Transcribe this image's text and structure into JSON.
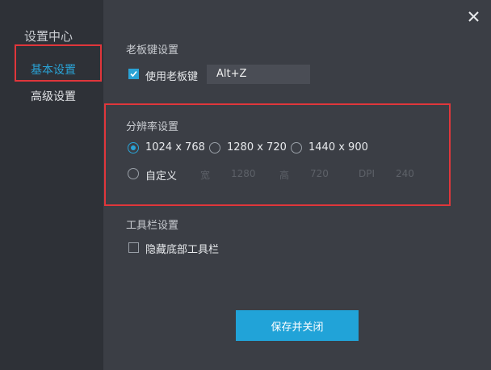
{
  "sidebar": {
    "title": "设置中心",
    "items": [
      {
        "label": "基本设置",
        "active": true
      },
      {
        "label": "高级设置",
        "active": false
      }
    ]
  },
  "close_icon": "close-icon",
  "boss_key": {
    "section_title": "老板键设置",
    "checkbox_label": "使用老板键",
    "checked": true,
    "hotkey_value": "Alt+Z"
  },
  "resolution": {
    "section_title": "分辨率设置",
    "options": [
      {
        "label": "1024 x 768",
        "selected": true
      },
      {
        "label": "1280 x 720",
        "selected": false
      },
      {
        "label": "1440 x 900",
        "selected": false
      }
    ],
    "custom": {
      "label": "自定义",
      "width_label": "宽",
      "width_value": "1280",
      "height_label": "高",
      "height_value": "720",
      "dpi_label": "DPI",
      "dpi_value": "240"
    }
  },
  "toolbar": {
    "section_title": "工具栏设置",
    "checkbox_label": "隐藏底部工具栏",
    "checked": false
  },
  "save_button": "保存并关闭",
  "colors": {
    "accent": "#21a3d8",
    "highlight_box": "#e0363b",
    "sidebar_bg": "#2e3137",
    "main_bg": "#3b3e45"
  }
}
